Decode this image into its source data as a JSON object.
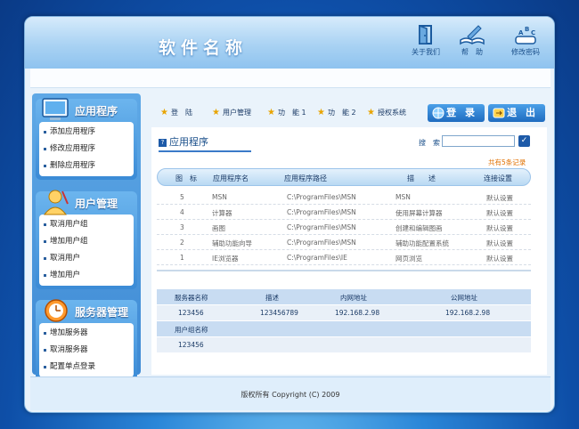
{
  "header": {
    "site_title": "软件名称",
    "buttons": [
      {
        "label": "关于我们",
        "icon": "door-icon"
      },
      {
        "label": "帮　助",
        "icon": "book-icon"
      },
      {
        "label": "修改密码",
        "icon": "abc-icon"
      }
    ]
  },
  "sidebar": {
    "sections": [
      {
        "title": "应用程序",
        "icon": "computer-icon",
        "items": [
          "添加应用程序",
          "修改应用程序",
          "删除应用程序"
        ]
      },
      {
        "title": "用户管理",
        "icon": "user-icon",
        "items": [
          "取消用户组",
          "增加用户组",
          "取消用户",
          "增加用户"
        ]
      },
      {
        "title": "服务器管理",
        "icon": "server-icon",
        "items": [
          "增加服务器",
          "取消服务器",
          "配置单点登录"
        ]
      }
    ]
  },
  "menu": {
    "items": [
      "登　陆",
      "用户管理",
      "功　能 1",
      "功　能 2",
      "授权系统"
    ],
    "login_button": "登 录",
    "logout_button": "退 出"
  },
  "main": {
    "title": "应用程序",
    "search_label": "搜　索",
    "search_value": "",
    "record_count": "共有5条记录",
    "table": {
      "headers": [
        "图　标",
        "应用程序名",
        "应用程序路径",
        "描　　述",
        "连接设置"
      ],
      "rows": [
        [
          "5",
          "MSN",
          "C:\\ProgramFiles\\MSN",
          "MSN",
          "默认设置"
        ],
        [
          "4",
          "计算器",
          "C:\\ProgramFiles\\MSN",
          "使用屏幕计算器",
          "默认设置"
        ],
        [
          "3",
          "画图",
          "C:\\ProgramFiles\\MSN",
          "创建和编辑图画",
          "默认设置"
        ],
        [
          "2",
          "辅助功能向导",
          "C:\\ProgramFiles\\MSN",
          "辅助功能配置系统",
          "默认设置"
        ],
        [
          "1",
          "IE浏览器",
          "C:\\ProgramFiles\\IE",
          "网页浏览",
          "默认设置"
        ]
      ]
    },
    "server": {
      "headers": [
        "服务器名称",
        "描述",
        "内网地址",
        "公网地址"
      ],
      "values": [
        "123456",
        "123456789",
        "192.168.2.98",
        "192.168.2.98"
      ],
      "group_header": "用户组名称",
      "group_value": "123456"
    }
  },
  "footer": {
    "copyright": "版权所有  Copyright (C) 2009"
  },
  "colors": {
    "accent": "#1d5aa8",
    "count": "#e07000"
  }
}
